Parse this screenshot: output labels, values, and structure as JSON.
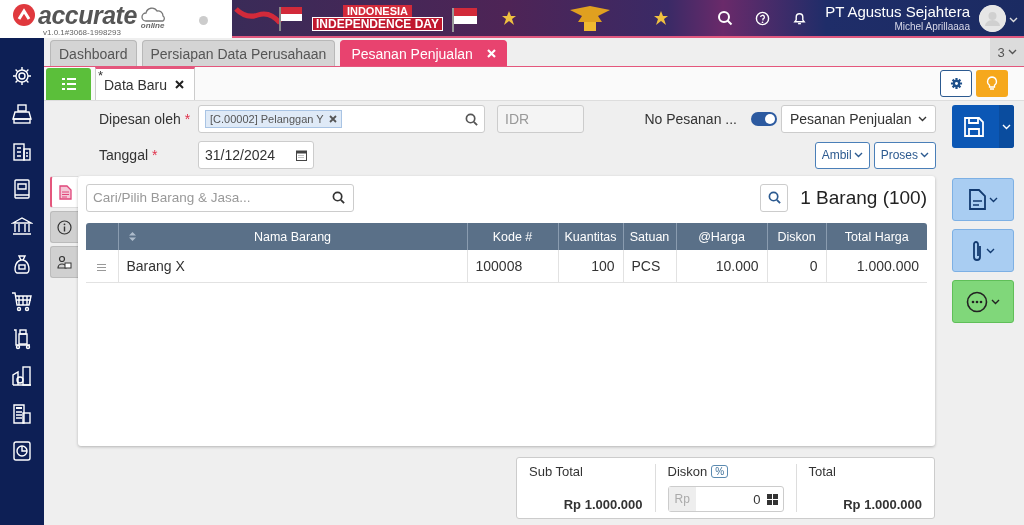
{
  "header": {
    "logo_text": "accurate",
    "logo_sub": "online",
    "version": "v1.0.1#3068-1998293",
    "banner_line1": "INDONESIA",
    "banner_line2": "INDEPENDENCE DAY",
    "company": "PT Agustus Sejahtera",
    "user": "Michel Aprillaaaa"
  },
  "tabs": [
    {
      "label": "Dashboard",
      "selected": false,
      "closable": false
    },
    {
      "label": "Persiapan Data Perusahaan",
      "selected": false,
      "closable": false
    },
    {
      "label": "Pesanan Penjualan",
      "selected": true,
      "closable": true
    }
  ],
  "tab_overflow": {
    "count": "3"
  },
  "doc_tabs": [
    {
      "label": "Data Baru",
      "modified_mark": "*",
      "selected": true
    }
  ],
  "form": {
    "customer": {
      "label": "Dipesan oleh",
      "required_mark": "*",
      "chip": "[C.00002] Pelanggan Y"
    },
    "currency": {
      "value": "IDR",
      "disabled": true
    },
    "number": {
      "label": "No Pesanan ...",
      "auto": true
    },
    "type_select": {
      "value": "Pesanan Penjualan"
    },
    "date": {
      "label": "Tanggal",
      "required_mark": "*",
      "value": "31/12/2024"
    },
    "buttons": [
      {
        "label": "Ambil"
      },
      {
        "label": "Proses"
      }
    ]
  },
  "side_tabs": [
    {
      "kind": "document",
      "selected": true
    },
    {
      "kind": "info",
      "selected": false
    },
    {
      "kind": "person",
      "selected": false
    }
  ],
  "items": {
    "search_placeholder": "Cari/Pilih Barang & Jasa...",
    "count": "1 Barang (100)",
    "columns": [
      {
        "label": "Nama Barang",
        "kind": "text",
        "sortable": true
      },
      {
        "label": "Kode #",
        "kind": "text",
        "sortable": false
      },
      {
        "label": "Kuantitas",
        "kind": "number",
        "sortable": false
      },
      {
        "label": "Satuan",
        "kind": "text",
        "sortable": false
      },
      {
        "label": "@Harga",
        "kind": "number",
        "sortable": false
      },
      {
        "label": "Diskon",
        "kind": "number",
        "sortable": false
      },
      {
        "label": "Total Harga",
        "kind": "number",
        "sortable": false
      }
    ],
    "rows": [
      {
        "cells": [
          "Barang X",
          "100008",
          "100",
          "PCS",
          "10.000",
          "0",
          "1.000.000"
        ]
      }
    ]
  },
  "summary": {
    "subtotal_label": "Sub Total",
    "subtotal": "Rp 1.000.000",
    "discount_label": "Diskon",
    "discount_mode": "%",
    "discount_prefix": "Rp",
    "discount_value": "0",
    "total_label": "Total",
    "total": "Rp 1.000.000"
  }
}
